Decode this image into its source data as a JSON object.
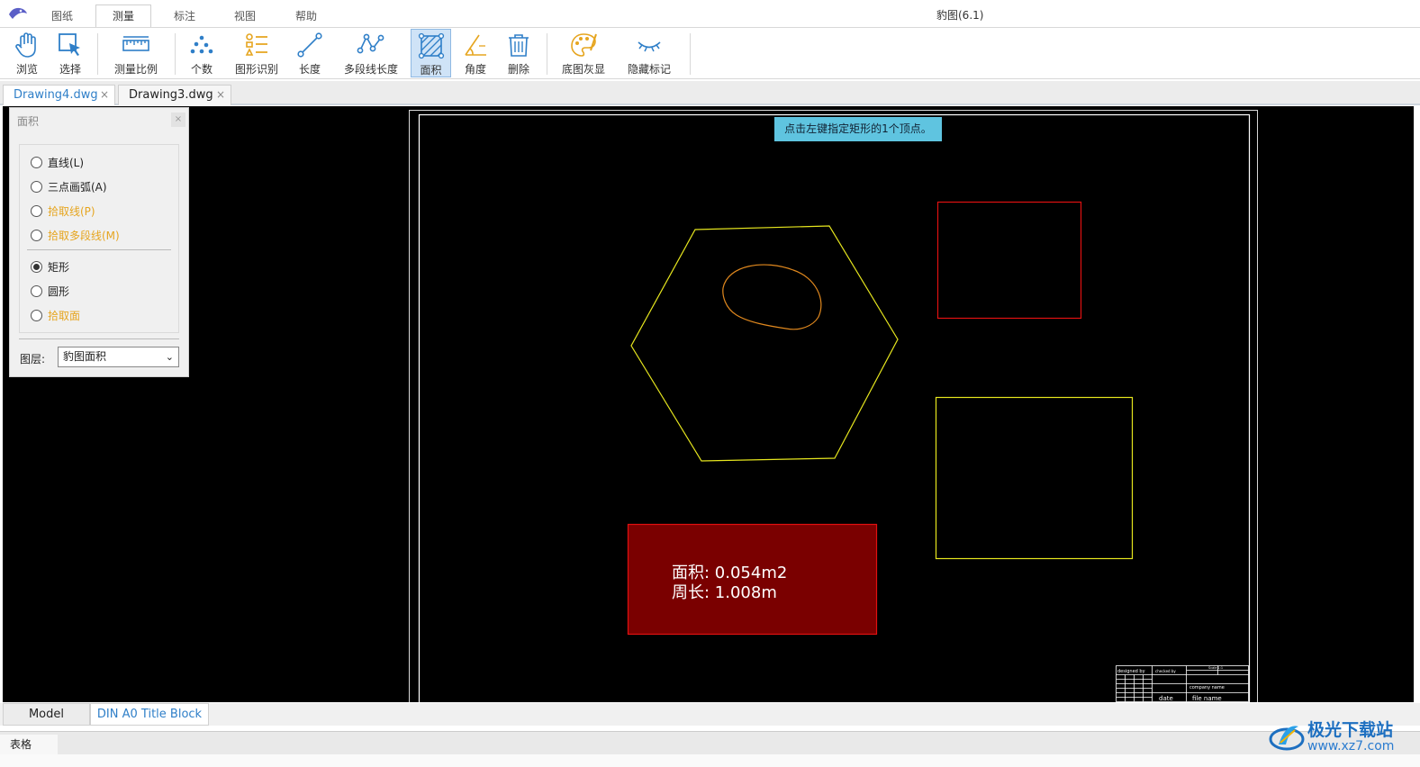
{
  "app": {
    "title": "豹图(6.1)"
  },
  "menu_tabs": [
    "图纸",
    "测量",
    "标注",
    "视图",
    "帮助"
  ],
  "ribbon": {
    "browse": "浏览",
    "select": "选择",
    "scale": "测量比例",
    "count": "个数",
    "shape_recognize": "图形识别",
    "length": "长度",
    "polyline_length": "多段线长度",
    "area": "面积",
    "angle": "角度",
    "delete": "删除",
    "gray_background": "底图灰显",
    "hide_marks": "隐藏标记"
  },
  "doc_tabs": [
    {
      "name": "Drawing4.dwg",
      "close": "×"
    },
    {
      "name": "Drawing3.dwg",
      "close": "×"
    }
  ],
  "panel": {
    "title": "面积",
    "close": "×",
    "options": [
      {
        "label": "直线(L)",
        "checked": false,
        "highlight": false
      },
      {
        "label": "三点画弧(A)",
        "checked": false,
        "highlight": false
      },
      {
        "label": "拾取线(P)",
        "checked": false,
        "highlight": true
      },
      {
        "label": "拾取多段线(M)",
        "checked": false,
        "highlight": true
      },
      {
        "label": "矩形",
        "checked": true,
        "highlight": false
      },
      {
        "label": "圆形",
        "checked": false,
        "highlight": false
      },
      {
        "label": "拾取面",
        "checked": false,
        "highlight": true
      }
    ],
    "layer_label": "图层:",
    "layer_value": "豹图面积"
  },
  "canvas": {
    "hint": "点击左键指定矩形的1个顶点。",
    "measure_area": "面积: 0.054m2",
    "measure_perimeter": "周长: 1.008m",
    "title_block": {
      "designed_by": "designed by",
      "checked_by": "checked by",
      "company_name": "company name",
      "date": "date",
      "file_name": "file name",
      "scale": "Scale 1:1"
    }
  },
  "layout_tabs": [
    "Model",
    "DIN A0 Title Block"
  ],
  "table_tab": "表格",
  "watermark": {
    "brand": "极光下载站",
    "url": "www.xz7.com"
  },
  "colors": {
    "accent_blue": "#2f7fc8",
    "highlight_orange": "#e6a51f",
    "hexagon_yellow": "#e6e61e",
    "red_rect": "#e01010",
    "measure_fill": "#7a0000",
    "hint_bg": "#5fc4e0"
  }
}
